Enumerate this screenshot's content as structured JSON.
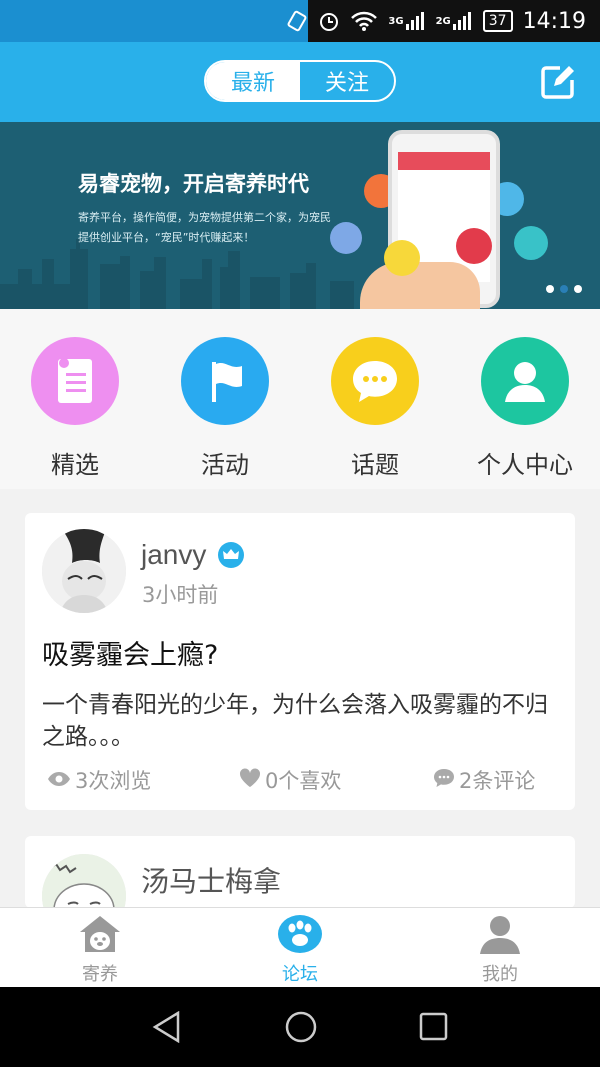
{
  "status_bar": {
    "battery": "37",
    "time": "14:19",
    "net1": "3G",
    "net2": "2G"
  },
  "header": {
    "tabs": [
      {
        "label": "最新",
        "active": true
      },
      {
        "label": "关注",
        "active": false
      }
    ],
    "edit_icon": "edit-icon"
  },
  "banner": {
    "title": "易睿宠物，开启寄养时代",
    "subtitle": "寄养平台，操作简便，为宠物提供第二个家，为宠民提供创业平台，“宠民”时代赚起来！",
    "slides_total": 3,
    "slide_active": 2
  },
  "quick_nav": [
    {
      "label": "精选",
      "icon": "document-icon",
      "color": "#ee8ff0"
    },
    {
      "label": "活动",
      "icon": "flag-icon",
      "color": "#29aaf0"
    },
    {
      "label": "话题",
      "icon": "chat-icon",
      "color": "#f8cf1c"
    },
    {
      "label": "个人中心",
      "icon": "person-icon",
      "color": "#1dc6a0"
    }
  ],
  "posts": [
    {
      "username": "janvy",
      "time": "3小时前",
      "title": "吸雾霾会上瘾?",
      "body": "一个青春阳光的少年，为什么会落入吸雾霾的不归之路。。。",
      "views": "3次浏览",
      "likes": "0个喜欢",
      "comments": "2条评论"
    },
    {
      "username": "汤马士梅拿"
    }
  ],
  "tab_bar": [
    {
      "label": "寄养",
      "icon": "house-dog-icon",
      "active": false
    },
    {
      "label": "论坛",
      "icon": "paw-icon",
      "active": true
    },
    {
      "label": "我的",
      "icon": "user-icon",
      "active": false
    }
  ],
  "colors": {
    "accent": "#29b0ea",
    "inactive": "#999999"
  }
}
